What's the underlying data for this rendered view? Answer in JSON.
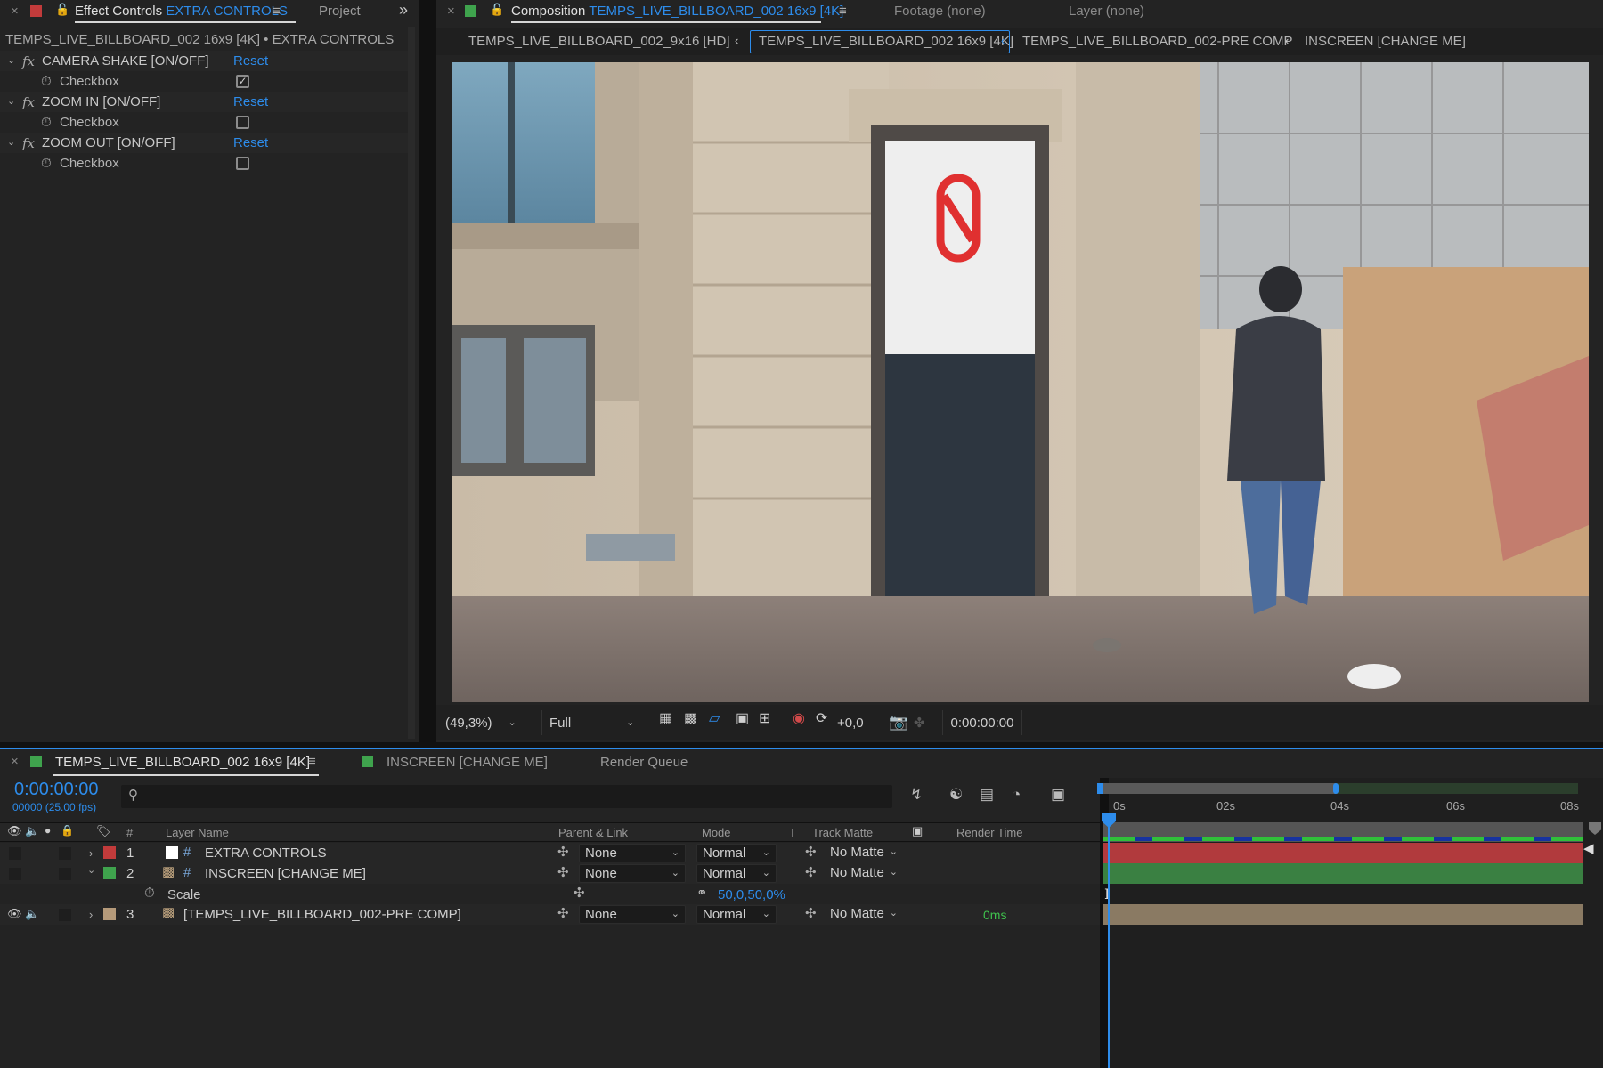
{
  "effect_controls": {
    "close": "×",
    "tab_title": "Effect Controls",
    "tab_layer": "EXTRA CONTROLS",
    "project_tab": "Project",
    "overflow": "»",
    "subtitle": "TEMPS_LIVE_BILLBOARD_002 16x9 [4K] • EXTRA CONTROLS",
    "effects": [
      {
        "name": "CAMERA SHAKE [ON/OFF]",
        "reset": "Reset",
        "param": "Checkbox",
        "checked": true
      },
      {
        "name": "ZOOM IN [ON/OFF]",
        "reset": "Reset",
        "param": "Checkbox",
        "checked": false
      },
      {
        "name": "ZOOM OUT [ON/OFF]",
        "reset": "Reset",
        "param": "Checkbox",
        "checked": false
      }
    ]
  },
  "viewer": {
    "close": "×",
    "comp_label": "Composition",
    "comp_name": "TEMPS_LIVE_BILLBOARD_002 16x9 [4K]",
    "footage_tab": "Footage (none)",
    "layer_tab": "Layer (none)",
    "breadcrumbs": [
      "TEMPS_LIVE_BILLBOARD_002_9x16  [HD]",
      "TEMPS_LIVE_BILLBOARD_002 16x9 [4K]",
      "TEMPS_LIVE_BILLBOARD_002-PRE COMP",
      "INSCREEN [CHANGE ME]"
    ],
    "zoom": "(49,3%)",
    "resolution": "Full",
    "exposure": "+0,0",
    "timecode": "0:00:00:00"
  },
  "timeline": {
    "close": "×",
    "tabs": [
      "TEMPS_LIVE_BILLBOARD_002 16x9 [4K]",
      "INSCREEN [CHANGE ME]",
      "Render Queue"
    ],
    "current_time": "0:00:00:00",
    "frame_info": "00000 (25.00 fps)",
    "search_placeholder": "",
    "columns": {
      "hash": "#",
      "layer_name": "Layer Name",
      "parent": "Parent & Link",
      "mode": "Mode",
      "t": "T",
      "track_matte": "Track Matte",
      "render_time": "Render Time"
    },
    "ruler": [
      "0s",
      "02s",
      "04s",
      "06s",
      "08s"
    ],
    "layers": [
      {
        "num": "1",
        "name": "EXTRA CONTROLS",
        "parent": "None",
        "mode": "Normal",
        "matte": "No Matte",
        "render_time": "",
        "label_color": "#c23b3b"
      },
      {
        "num": "2",
        "name": "INSCREEN [CHANGE ME]",
        "parent": "None",
        "mode": "Normal",
        "matte": "No Matte",
        "render_time": "",
        "label_color": "#3fa34d"
      },
      {
        "num": "3",
        "name": "[TEMPS_LIVE_BILLBOARD_002-PRE COMP]",
        "parent": "None",
        "mode": "Normal",
        "matte": "No Matte",
        "render_time": "0ms",
        "label_color": "#b59a7a"
      }
    ],
    "scale": {
      "label": "Scale",
      "value": "50,0,50,0%"
    }
  },
  "colors": {
    "accent": "#2d8ceb",
    "layer1": "#b13a3d",
    "layer2": "#3a8042",
    "layer3": "#8a7a63"
  }
}
